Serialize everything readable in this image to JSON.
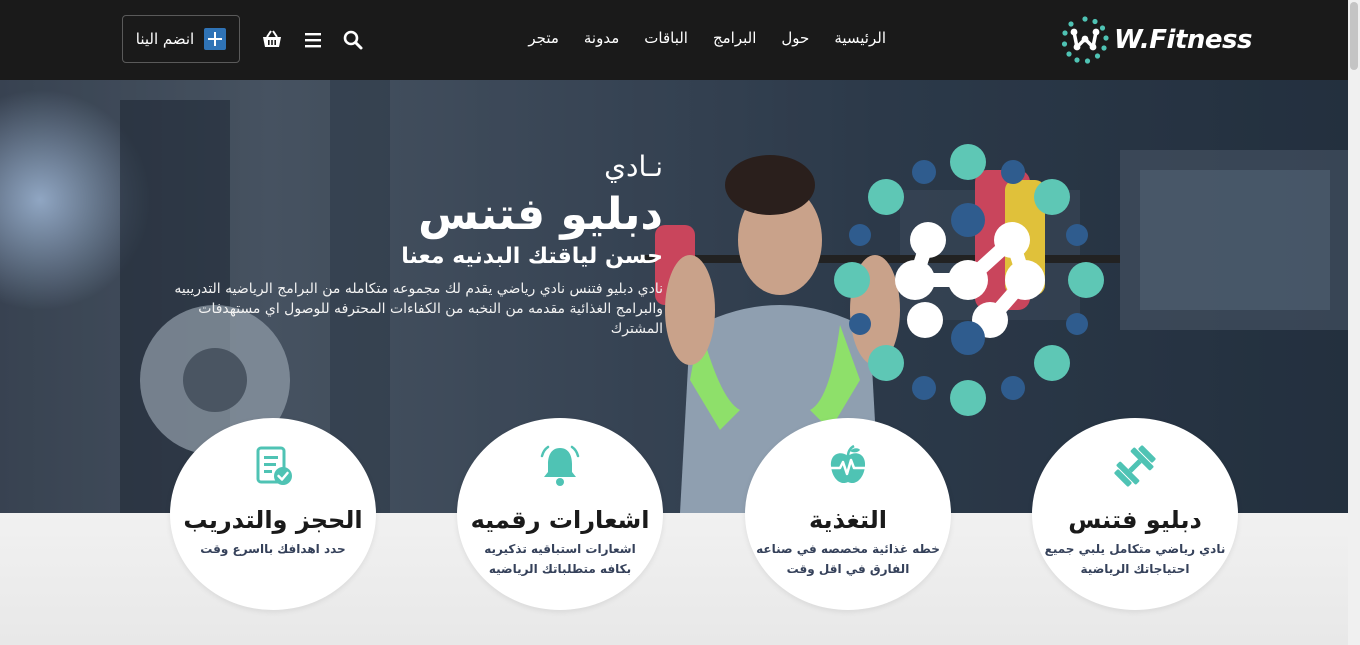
{
  "brand": {
    "name": "W.Fitness",
    "accent": "#4fc3b4",
    "accent_dark": "#2f4a6b"
  },
  "nav": {
    "items": [
      {
        "label": "الرئيسية"
      },
      {
        "label": "حول"
      },
      {
        "label": "البرامج"
      },
      {
        "label": "الباقات"
      },
      {
        "label": "مدونة"
      },
      {
        "label": "متجر"
      }
    ],
    "icons": [
      "search-icon",
      "menu-icon",
      "cart-icon"
    ],
    "join_label": "انضم الينا"
  },
  "hero": {
    "kicker": "نـادي",
    "title": "دبليو فتنس",
    "subtitle": "حسن لياقتك البدنيه معنا",
    "description": "نادي دبليو فتنس نادي رياضي يقدم لك مجموعه متكامله من البرامج الرياضيه التدريبيه والبرامج الغذائية مقدمه من النخبه من الكفاءات المحترفه للوصول اي مستهدفات المشترك"
  },
  "features": [
    {
      "icon": "dumbbell-icon",
      "title": "دبليو فتنس",
      "desc": "نادي رياضي متكامل يلبي جميع احتياجاتك الرياضية"
    },
    {
      "icon": "apple-heartbeat-icon",
      "title": "التغذية",
      "desc": "خطه غذائية مخصصه في صناعه الفارق في اقل وقت"
    },
    {
      "icon": "bell-icon",
      "title": "اشعارات رقميه",
      "desc": "اشعارات استباقيه تذكيريه بكافه متطلباتك الرياضيه"
    },
    {
      "icon": "clipboard-check-icon",
      "title": "الحجز والتدريب",
      "desc": "حدد اهدافك بااسرع وقت"
    }
  ]
}
